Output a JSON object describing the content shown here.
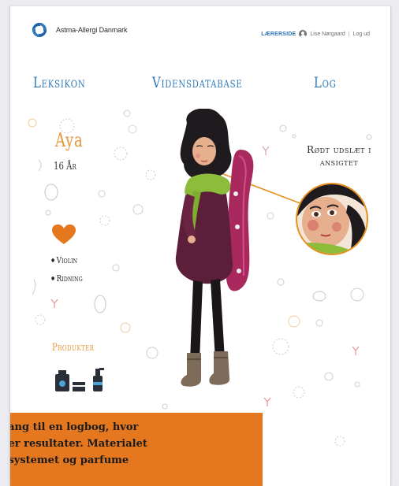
{
  "header": {
    "logo_text": "Astma-Allergi Danmark",
    "teacher_link": "LÆRERSIDE",
    "user_name": "Lise Nørgaard",
    "separator": "|",
    "logout": "Log ud"
  },
  "nav": {
    "items": [
      {
        "label": "Leksikon"
      },
      {
        "label": "Vidensdatabase"
      },
      {
        "label": "Log"
      }
    ]
  },
  "profile": {
    "name": "Aya",
    "age": "16 År",
    "hobbies": [
      "Violin",
      "Ridning"
    ],
    "products_heading": "Produkter"
  },
  "callout": {
    "line1": "Rødt udslæt i",
    "line2": "ansigtet"
  },
  "info": {
    "line1": "gang til en logbog, hvor",
    "line2": "ner resultater. Materialet",
    "line3": "nsystemet og parfume"
  },
  "colors": {
    "nav": "#2f79b9",
    "accent_orange": "#e8963a",
    "info_box": "#e5781f",
    "teacher_link": "#2e74b5"
  },
  "icons": [
    "logo-swirl-icon",
    "user-avatar-icon",
    "heart-icon",
    "cosmetics-icon"
  ]
}
